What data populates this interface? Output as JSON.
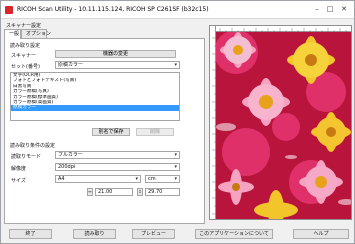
{
  "window": {
    "title": "RICOH Scan Utility - 10.11.115.124, RICOH SP C261SF (b32c15)",
    "min_glyph": "–",
    "max_glyph": "□",
    "close_glyph": "✕"
  },
  "settings": {
    "group_label": "スキャナー設定",
    "tabs": [
      "一般",
      "オプション"
    ]
  },
  "general": {
    "read_settings_label": "読み取り設定",
    "scanner_label": "スキャナー",
    "change_scanner_button": "機器の変更",
    "preset_label": "セット(番号)",
    "preset_value": "原稿カラー",
    "list_items": [
      "文字(OCR用)",
      "フォトとフォトテキスト(写真)",
      "白黒写真",
      "カラー原稿(写真)",
      "カラー原稿(標準画質)",
      "カラー原稿(高画質)",
      "原稿カラー"
    ],
    "selected_index": 6,
    "save_button": "別名で保存",
    "delete_button": "削除",
    "read_conditions_label": "読み取り条件の設定",
    "mode_label": "読取りモード",
    "mode_value": "フルカラー",
    "resolution_label": "解像度",
    "resolution_value": "200dpi",
    "size_label": "サイズ",
    "size_value": "A4",
    "unit_value": "cm",
    "width_value": "21.00",
    "height_value": "29.70"
  },
  "footer": {
    "close_button": "終了",
    "scan_button": "読み取り",
    "preview_button": "プレビュー",
    "about_button": "このアプリケーションについて",
    "help_button": "ヘルプ"
  },
  "colors": {
    "selection": "#3399ff",
    "title_icon": "#d9262b"
  }
}
